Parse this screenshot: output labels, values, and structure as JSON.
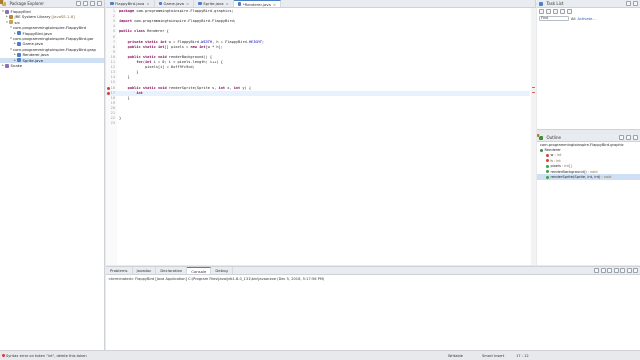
{
  "package_explorer": {
    "title": "Package Explorer",
    "items": [
      {
        "label": "FlappyBird",
        "extra": "",
        "icon": "project-icon",
        "indent": 0,
        "expanded": true
      },
      {
        "label": "JRE System Library",
        "extra": "[JavaSE-1.8]",
        "icon": "library-icon",
        "indent": 1,
        "expanded": false
      },
      {
        "label": "src",
        "extra": "",
        "icon": "source-folder-icon",
        "indent": 1,
        "expanded": true
      },
      {
        "label": "com.programmingtoinspire.FlappyBird",
        "extra": "",
        "icon": "package-icon",
        "indent": 2,
        "expanded": true
      },
      {
        "label": "FlappyBird.java",
        "extra": "",
        "icon": "java-file-icon",
        "indent": 3,
        "expanded": false
      },
      {
        "label": "com.programmingtoinspire.FlappyBird.gar",
        "extra": "",
        "icon": "package-icon",
        "indent": 2,
        "expanded": true
      },
      {
        "label": "Game.java",
        "extra": "",
        "icon": "java-file-icon",
        "indent": 3,
        "expanded": false
      },
      {
        "label": "com.programmingtoinspire.FlappyBird.grap",
        "extra": "",
        "icon": "package-icon",
        "indent": 2,
        "expanded": true
      },
      {
        "label": "Renderer.java",
        "extra": "",
        "icon": "java-file-icon",
        "indent": 3,
        "expanded": false
      },
      {
        "label": "Sprite.java",
        "extra": "",
        "icon": "java-file-icon",
        "indent": 3,
        "expanded": false
      },
      {
        "label": "Snake",
        "extra": "",
        "icon": "project-icon",
        "indent": 0,
        "expanded": false
      }
    ]
  },
  "editor": {
    "tabs": [
      {
        "label": "FlappyBird.java",
        "active": false
      },
      {
        "label": "Game.java",
        "active": false
      },
      {
        "label": "Sprite.java",
        "active": false
      },
      {
        "label": "*Renderer.java",
        "active": true
      }
    ],
    "lines": [
      "package com.programmingtoinspire.FlappyBird.graphics;",
      "",
      "import com.programmingtoinspire.FlappyBird.FlappyBird;",
      "",
      "public class Renderer {",
      "",
      "    private static int w = FlappyBird.WIDTH, h = FlappyBird.HEIGHT;",
      "    public static int[] pixels = new int[w * h];",
      "",
      "    public static void renderBackground() {",
      "        for(int i = 0; i < pixels.length; i++) {",
      "            pixels[i] = 0xff9fc9cd;",
      "        }",
      "    }",
      "",
      "    public static void renderSprite(Sprite s, int x, int y) {",
      "        int",
      "    }",
      "",
      "",
      "",
      "}",
      ""
    ],
    "current_line": 17,
    "error_lines": [
      16,
      17
    ]
  },
  "task_list": {
    "title": "Task List",
    "find_placeholder": "Find",
    "all_label": "All",
    "activate_label": "Activate..."
  },
  "outline": {
    "title": "Outline",
    "items": [
      {
        "label": "com.programmingtoinspire.FlappyBird.graphic",
        "type": "",
        "kind": "pkg",
        "indent": 0,
        "selected": false
      },
      {
        "label": "Renderer",
        "type": "",
        "kind": "cls",
        "indent": 0,
        "selected": false
      },
      {
        "label": "w",
        "type": ": int",
        "kind": "red",
        "indent": 1,
        "selected": false
      },
      {
        "label": "h",
        "type": ": int",
        "kind": "red",
        "indent": 1,
        "selected": false
      },
      {
        "label": "pixels",
        "type": ": int[]",
        "kind": "green",
        "indent": 1,
        "selected": false
      },
      {
        "label": "renderBackground()",
        "type": ": void",
        "kind": "green",
        "indent": 1,
        "selected": false
      },
      {
        "label": "renderSprite(Sprite, int, int)",
        "type": ": void",
        "kind": "green",
        "indent": 1,
        "selected": true
      }
    ]
  },
  "console": {
    "tabs": [
      "Problems",
      "Javadoc",
      "Declaration",
      "Console",
      "Debug"
    ],
    "active_tab": "Console",
    "text": "<terminated> FlappyBird [Java Application] C:\\Program Files\\Java\\jdk1.8.0_131\\bin\\javaw.exe (Dec 5, 2016, 5:17:56 PM)"
  },
  "status": {
    "message": "Syntax error on token \"int\", delete this token",
    "mode": "Writable",
    "insert": "Smart Insert",
    "position": "17 : 12"
  },
  "colors": {
    "keyword": "#7f0055",
    "constant": "#0000c0",
    "selection": "#cfe0f5",
    "current_line": "#e8f2fe",
    "error": "#d43f3a"
  }
}
